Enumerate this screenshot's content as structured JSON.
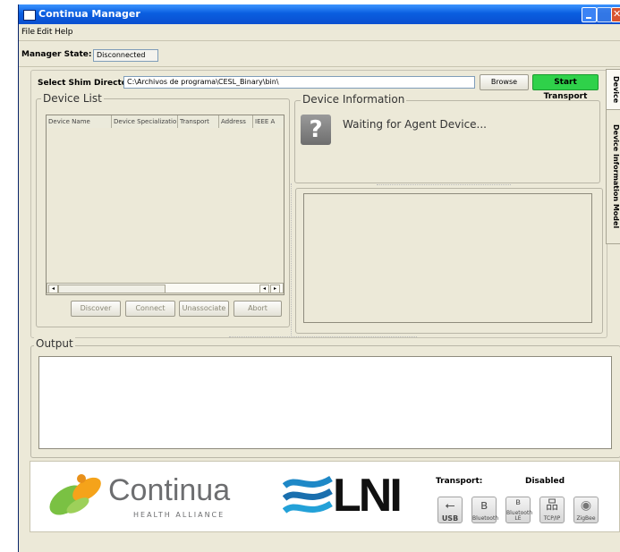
{
  "window": {
    "title": "Continua Manager"
  },
  "menu": [
    "File",
    "Edit",
    "Help"
  ],
  "manager_state": {
    "label": "Manager State:",
    "value": "Disconnected"
  },
  "shim": {
    "label": "Select Shim Directory:",
    "path": "C:\\Archivos de programa\\CESL_Binary\\bin\\",
    "browse": "Browse",
    "start": "Start Transport"
  },
  "device_list": {
    "legend": "Device List",
    "columns": [
      "Device Name",
      "Device Specializatio",
      "Transport",
      "Address",
      "IEEE A"
    ],
    "buttons": [
      "Discover",
      "Connect",
      "Unassociate",
      "Abort"
    ]
  },
  "device_info": {
    "legend": "Device Information",
    "message": "Waiting for Agent Device...",
    "icon": "question-icon"
  },
  "tabs": [
    "Device",
    "Device Information Model"
  ],
  "output": {
    "legend": "Output"
  },
  "footer": {
    "continua": {
      "name": "Continua",
      "tagline": "HEALTH ALLIANCE"
    },
    "lni": "LNI",
    "transport_label": "Transport:",
    "transport_status": "Disabled",
    "transports": [
      {
        "name": "usb-icon",
        "label": "USB"
      },
      {
        "name": "bluetooth-icon",
        "label": "Bluetooth"
      },
      {
        "name": "bluetooth-le-icon",
        "label": "Bluetooth LE"
      },
      {
        "name": "tcpip-icon",
        "label": "TCP/IP"
      },
      {
        "name": "zigbee-icon",
        "label": "ZigBee"
      }
    ]
  },
  "colors": {
    "title_bar": "#0a5ee0",
    "start_button": "#2fd14a",
    "continua_green": "#7ac143",
    "continua_orange": "#f5a31a",
    "lni_blue": "#1e88c7"
  }
}
